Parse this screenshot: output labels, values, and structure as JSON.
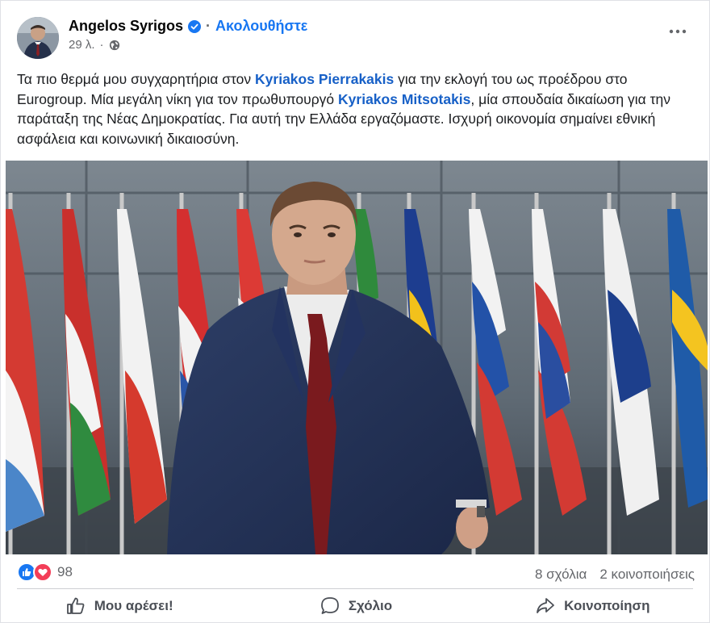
{
  "author": {
    "name": "Angelos Syrigos",
    "follow_label": "Ακολουθήστε",
    "separator": "·",
    "time": "29 λ.",
    "time_separator": "·"
  },
  "post": {
    "segments": [
      {
        "text": "Τα πιο θερμά μου συγχαρητήρια στον ",
        "type": "text"
      },
      {
        "text": "Kyriakos Pierrakakis",
        "type": "mention"
      },
      {
        "text": " για την εκλογή του ως προέδρου στο Eurogroup. Μία μεγάλη νίκη για τον πρωθυπουργό ",
        "type": "text"
      },
      {
        "text": "Kyriakos Mitsotakis",
        "type": "mention"
      },
      {
        "text": ", μία σπουδαία δικαίωση για την παράταξη της Νέας Δημοκρατίας. Για αυτή την Ελλάδα εργαζόμαστε. Ισχυρή οικονομία σημαίνει εθνική ασφάλεια και κοινωνική δικαιοσύνη.",
        "type": "text"
      }
    ]
  },
  "reactions": {
    "count": "98",
    "icons": [
      "like-icon",
      "love-icon"
    ]
  },
  "stats": {
    "comments": "8 σχόλια",
    "shares": "2 κοινοποιήσεις"
  },
  "actions": {
    "like": "Μου αρέσει!",
    "comment": "Σχόλιο",
    "share": "Κοινοποίηση"
  },
  "colors": {
    "link_blue": "#1877f2",
    "mention_blue": "#1760c7",
    "muted": "#65676b"
  }
}
